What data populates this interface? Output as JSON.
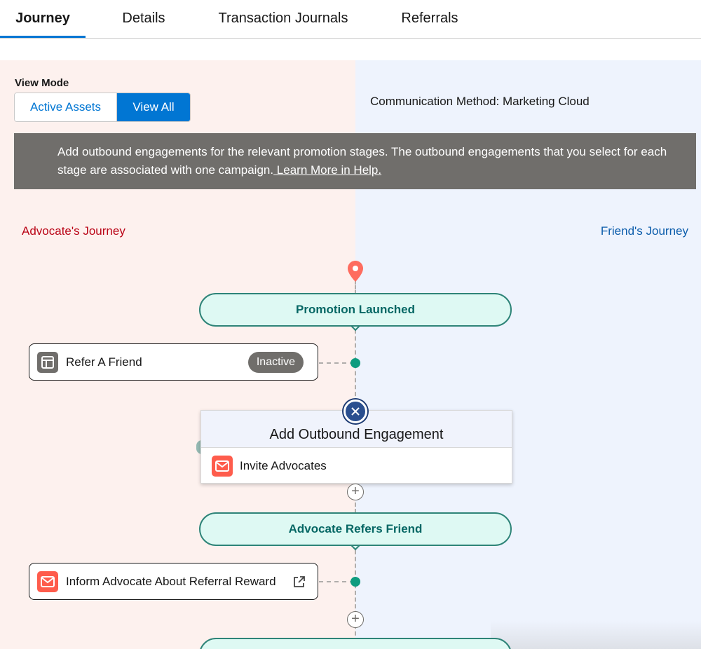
{
  "tabs": [
    {
      "label": "Journey",
      "active": true
    },
    {
      "label": "Details",
      "active": false
    },
    {
      "label": "Transaction Journals",
      "active": false
    },
    {
      "label": "Referrals",
      "active": false
    }
  ],
  "view_mode": {
    "label": "View Mode",
    "options": [
      "Active Assets",
      "View All"
    ],
    "selected": "View All"
  },
  "communication_method": "Communication Method: Marketing Cloud",
  "banner": {
    "text": "Add outbound engagements for the relevant promotion stages. The outbound engagements that you select for each stage are associated with one campaign.",
    "link": " Learn More in Help."
  },
  "journeys": {
    "advocate": "Advocate's Journey",
    "friend": "Friend's Journey"
  },
  "stages": [
    {
      "label": "Promotion Launched"
    },
    {
      "label": "Advocate Refers Friend"
    }
  ],
  "assets": [
    {
      "label": "Refer A Friend",
      "badge": "Inactive",
      "icon": "page-layout-icon"
    },
    {
      "label": "Inform Advocate About Referral Reward",
      "icon": "email-icon"
    }
  ],
  "popover": {
    "title": "Add Outbound Engagement",
    "items": [
      {
        "label": "Invite Advocates",
        "icon": "email-icon"
      }
    ]
  },
  "colors": {
    "brand": "#0176d3",
    "stage_border": "#2e8478",
    "stage_fill": "#def9f3",
    "advocate_text": "#ba0517",
    "friend_text": "#0b5cab",
    "email_icon": "#fe5c4c",
    "pin": "#fe6c5f"
  }
}
